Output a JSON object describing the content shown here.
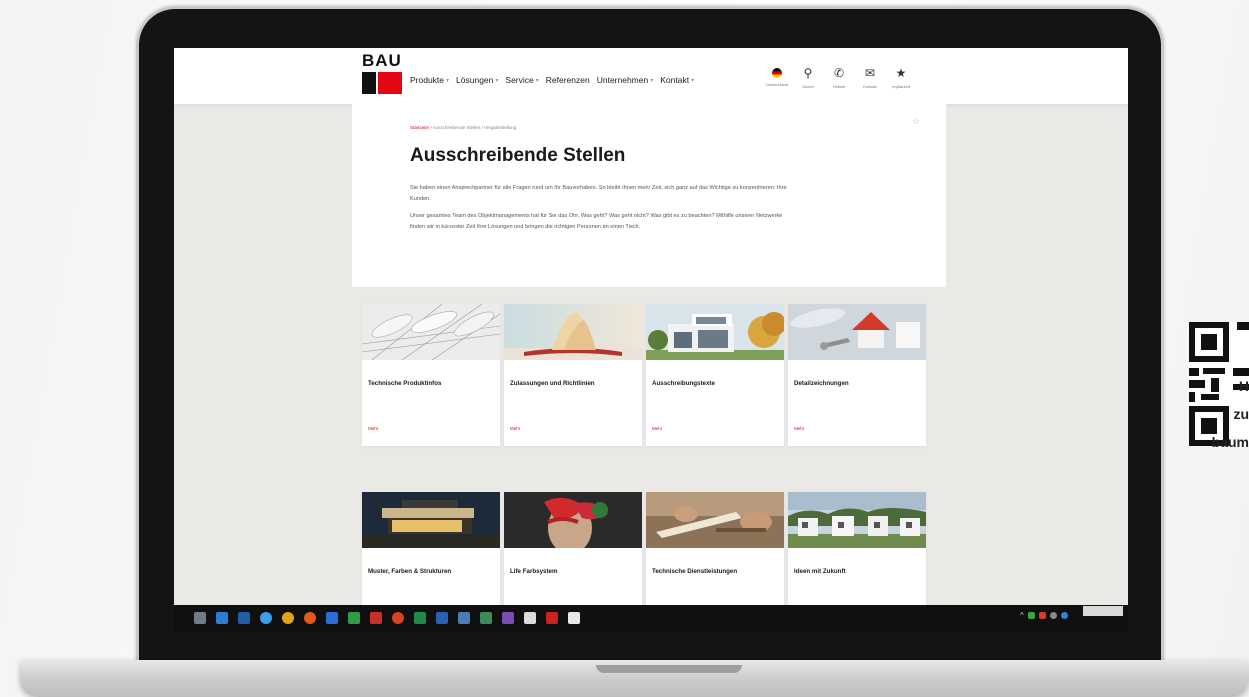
{
  "header": {
    "logo_text": "BAU",
    "nav": [
      {
        "label": "Produkte",
        "dropdown": true
      },
      {
        "label": "Lösungen",
        "dropdown": true
      },
      {
        "label": "Service",
        "dropdown": true
      },
      {
        "label": "Referenzen",
        "dropdown": false
      },
      {
        "label": "Unternehmen",
        "dropdown": true
      },
      {
        "label": "Kontakt",
        "dropdown": true
      }
    ],
    "utility": [
      {
        "label": "Deutschland",
        "icon": "flag-icon"
      },
      {
        "label": "Suche",
        "icon": "search-icon"
      },
      {
        "label": "Hotline",
        "icon": "phone-icon"
      },
      {
        "label": "Kontakt",
        "icon": "mail-icon"
      },
      {
        "label": "myBaumit",
        "icon": "star-icon"
      }
    ]
  },
  "intro": {
    "breadcrumb_home": "Startseite",
    "breadcrumb_current": "Ausschreibende Stellen / Vergabestellung",
    "title": "Ausschreibende Stellen",
    "paragraph1": "Sie haben einen Ansprechpartner für alle Fragen rund um Ihr Bauvorhaben. So bleibt Ihnen mehr Zeit, sich ganz auf das Wichtige zu konzentrieren: Ihre Kunden.",
    "paragraph2": "Unser gesamtes Team des Objektmanagements hat für Sie das Ohr. Was geht? Was geht nicht? Was gibt es zu beachten? Mithilfe unserer Netzwerke finden wir in kürzester Zeit Ihre Lösungen und bringen die richtigen Personen an einen Tisch."
  },
  "tiles_row1": [
    {
      "title": "Technische Produktinfos",
      "more": "Mehr"
    },
    {
      "title": "Zulassungen und Richtlinien",
      "more": "Mehr"
    },
    {
      "title": "Ausschreibungstexte",
      "more": "Mehr"
    },
    {
      "title": "Detailzeichnungen",
      "more": "Mehr"
    }
  ],
  "tiles_row2": [
    {
      "title": "Muster, Farben & Strukturen"
    },
    {
      "title": "Life Farbsystem"
    },
    {
      "title": "Technische Dienstleistungen"
    },
    {
      "title": "Ideen mit Zukunft"
    }
  ],
  "side_promo": {
    "line1": "H",
    "line2": "zu",
    "line3": "baum"
  },
  "colors": {
    "brand_red": "#e30613",
    "taskbar": "#101010"
  }
}
